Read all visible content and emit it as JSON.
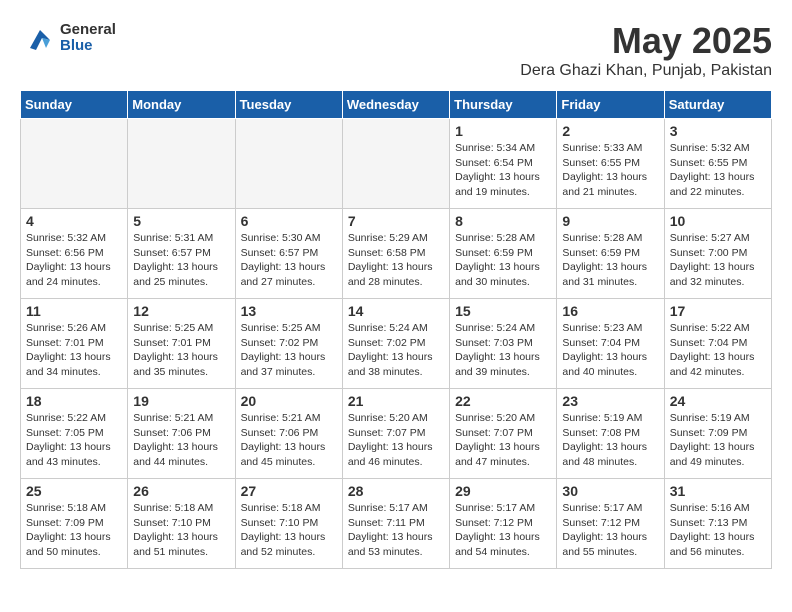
{
  "header": {
    "logo_general": "General",
    "logo_blue": "Blue",
    "month": "May 2025",
    "location": "Dera Ghazi Khan, Punjab, Pakistan"
  },
  "days_of_week": [
    "Sunday",
    "Monday",
    "Tuesday",
    "Wednesday",
    "Thursday",
    "Friday",
    "Saturday"
  ],
  "weeks": [
    [
      {
        "day": "",
        "info": ""
      },
      {
        "day": "",
        "info": ""
      },
      {
        "day": "",
        "info": ""
      },
      {
        "day": "",
        "info": ""
      },
      {
        "day": "1",
        "info": "Sunrise: 5:34 AM\nSunset: 6:54 PM\nDaylight: 13 hours\nand 19 minutes."
      },
      {
        "day": "2",
        "info": "Sunrise: 5:33 AM\nSunset: 6:55 PM\nDaylight: 13 hours\nand 21 minutes."
      },
      {
        "day": "3",
        "info": "Sunrise: 5:32 AM\nSunset: 6:55 PM\nDaylight: 13 hours\nand 22 minutes."
      }
    ],
    [
      {
        "day": "4",
        "info": "Sunrise: 5:32 AM\nSunset: 6:56 PM\nDaylight: 13 hours\nand 24 minutes."
      },
      {
        "day": "5",
        "info": "Sunrise: 5:31 AM\nSunset: 6:57 PM\nDaylight: 13 hours\nand 25 minutes."
      },
      {
        "day": "6",
        "info": "Sunrise: 5:30 AM\nSunset: 6:57 PM\nDaylight: 13 hours\nand 27 minutes."
      },
      {
        "day": "7",
        "info": "Sunrise: 5:29 AM\nSunset: 6:58 PM\nDaylight: 13 hours\nand 28 minutes."
      },
      {
        "day": "8",
        "info": "Sunrise: 5:28 AM\nSunset: 6:59 PM\nDaylight: 13 hours\nand 30 minutes."
      },
      {
        "day": "9",
        "info": "Sunrise: 5:28 AM\nSunset: 6:59 PM\nDaylight: 13 hours\nand 31 minutes."
      },
      {
        "day": "10",
        "info": "Sunrise: 5:27 AM\nSunset: 7:00 PM\nDaylight: 13 hours\nand 32 minutes."
      }
    ],
    [
      {
        "day": "11",
        "info": "Sunrise: 5:26 AM\nSunset: 7:01 PM\nDaylight: 13 hours\nand 34 minutes."
      },
      {
        "day": "12",
        "info": "Sunrise: 5:25 AM\nSunset: 7:01 PM\nDaylight: 13 hours\nand 35 minutes."
      },
      {
        "day": "13",
        "info": "Sunrise: 5:25 AM\nSunset: 7:02 PM\nDaylight: 13 hours\nand 37 minutes."
      },
      {
        "day": "14",
        "info": "Sunrise: 5:24 AM\nSunset: 7:02 PM\nDaylight: 13 hours\nand 38 minutes."
      },
      {
        "day": "15",
        "info": "Sunrise: 5:24 AM\nSunset: 7:03 PM\nDaylight: 13 hours\nand 39 minutes."
      },
      {
        "day": "16",
        "info": "Sunrise: 5:23 AM\nSunset: 7:04 PM\nDaylight: 13 hours\nand 40 minutes."
      },
      {
        "day": "17",
        "info": "Sunrise: 5:22 AM\nSunset: 7:04 PM\nDaylight: 13 hours\nand 42 minutes."
      }
    ],
    [
      {
        "day": "18",
        "info": "Sunrise: 5:22 AM\nSunset: 7:05 PM\nDaylight: 13 hours\nand 43 minutes."
      },
      {
        "day": "19",
        "info": "Sunrise: 5:21 AM\nSunset: 7:06 PM\nDaylight: 13 hours\nand 44 minutes."
      },
      {
        "day": "20",
        "info": "Sunrise: 5:21 AM\nSunset: 7:06 PM\nDaylight: 13 hours\nand 45 minutes."
      },
      {
        "day": "21",
        "info": "Sunrise: 5:20 AM\nSunset: 7:07 PM\nDaylight: 13 hours\nand 46 minutes."
      },
      {
        "day": "22",
        "info": "Sunrise: 5:20 AM\nSunset: 7:07 PM\nDaylight: 13 hours\nand 47 minutes."
      },
      {
        "day": "23",
        "info": "Sunrise: 5:19 AM\nSunset: 7:08 PM\nDaylight: 13 hours\nand 48 minutes."
      },
      {
        "day": "24",
        "info": "Sunrise: 5:19 AM\nSunset: 7:09 PM\nDaylight: 13 hours\nand 49 minutes."
      }
    ],
    [
      {
        "day": "25",
        "info": "Sunrise: 5:18 AM\nSunset: 7:09 PM\nDaylight: 13 hours\nand 50 minutes."
      },
      {
        "day": "26",
        "info": "Sunrise: 5:18 AM\nSunset: 7:10 PM\nDaylight: 13 hours\nand 51 minutes."
      },
      {
        "day": "27",
        "info": "Sunrise: 5:18 AM\nSunset: 7:10 PM\nDaylight: 13 hours\nand 52 minutes."
      },
      {
        "day": "28",
        "info": "Sunrise: 5:17 AM\nSunset: 7:11 PM\nDaylight: 13 hours\nand 53 minutes."
      },
      {
        "day": "29",
        "info": "Sunrise: 5:17 AM\nSunset: 7:12 PM\nDaylight: 13 hours\nand 54 minutes."
      },
      {
        "day": "30",
        "info": "Sunrise: 5:17 AM\nSunset: 7:12 PM\nDaylight: 13 hours\nand 55 minutes."
      },
      {
        "day": "31",
        "info": "Sunrise: 5:16 AM\nSunset: 7:13 PM\nDaylight: 13 hours\nand 56 minutes."
      }
    ]
  ]
}
